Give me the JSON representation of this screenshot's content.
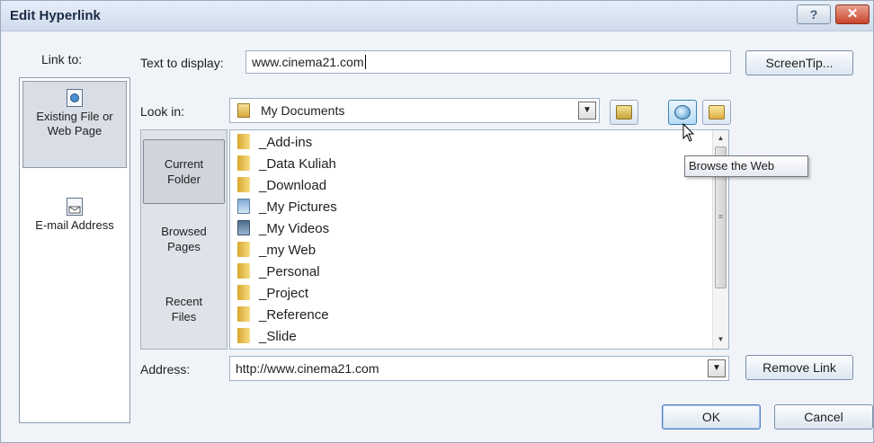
{
  "window": {
    "title": "Edit Hyperlink",
    "help_glyph": "?",
    "close_glyph": "✕"
  },
  "link_to": {
    "label": "Link to:",
    "items": [
      {
        "label_line1": "Existing File or",
        "label_line2": "Web Page",
        "selected": true
      },
      {
        "label_line1": "E-mail Address",
        "label_line2": "",
        "selected": false
      }
    ]
  },
  "text_to_display": {
    "label": "Text to display:",
    "value": "www.cinema21.com"
  },
  "screentip_button": "ScreenTip...",
  "look_in": {
    "label": "Look in:",
    "value": "My Documents"
  },
  "places": [
    {
      "line1": "Current",
      "line2": "Folder",
      "selected": true
    },
    {
      "line1": "Browsed",
      "line2": "Pages",
      "selected": false
    },
    {
      "line1": "Recent",
      "line2": "Files",
      "selected": false
    }
  ],
  "files": [
    {
      "name": "_Add-ins",
      "icon": "folder-icon"
    },
    {
      "name": "_Data Kuliah",
      "icon": "folder-icon"
    },
    {
      "name": "_Download",
      "icon": "folder-icon"
    },
    {
      "name": "_My Pictures",
      "icon": "pictures-folder-icon"
    },
    {
      "name": "_My Videos",
      "icon": "videos-folder-icon"
    },
    {
      "name": "_my Web",
      "icon": "folder-icon"
    },
    {
      "name": "_Personal",
      "icon": "folder-icon"
    },
    {
      "name": "_Project",
      "icon": "folder-icon"
    },
    {
      "name": "_Reference",
      "icon": "folder-icon"
    },
    {
      "name": "_Slide",
      "icon": "folder-icon"
    }
  ],
  "tooltip": "Browse the Web",
  "address": {
    "label": "Address:",
    "value": "http://www.cinema21.com"
  },
  "remove_link_button": "Remove Link",
  "ok_button": "OK",
  "cancel_button": "Cancel",
  "colors": {
    "title_bar": "#cfdcec",
    "dialog_bg": "#f0f4f9",
    "close_red": "#c8442c",
    "folder_gold": "#e8c055"
  }
}
